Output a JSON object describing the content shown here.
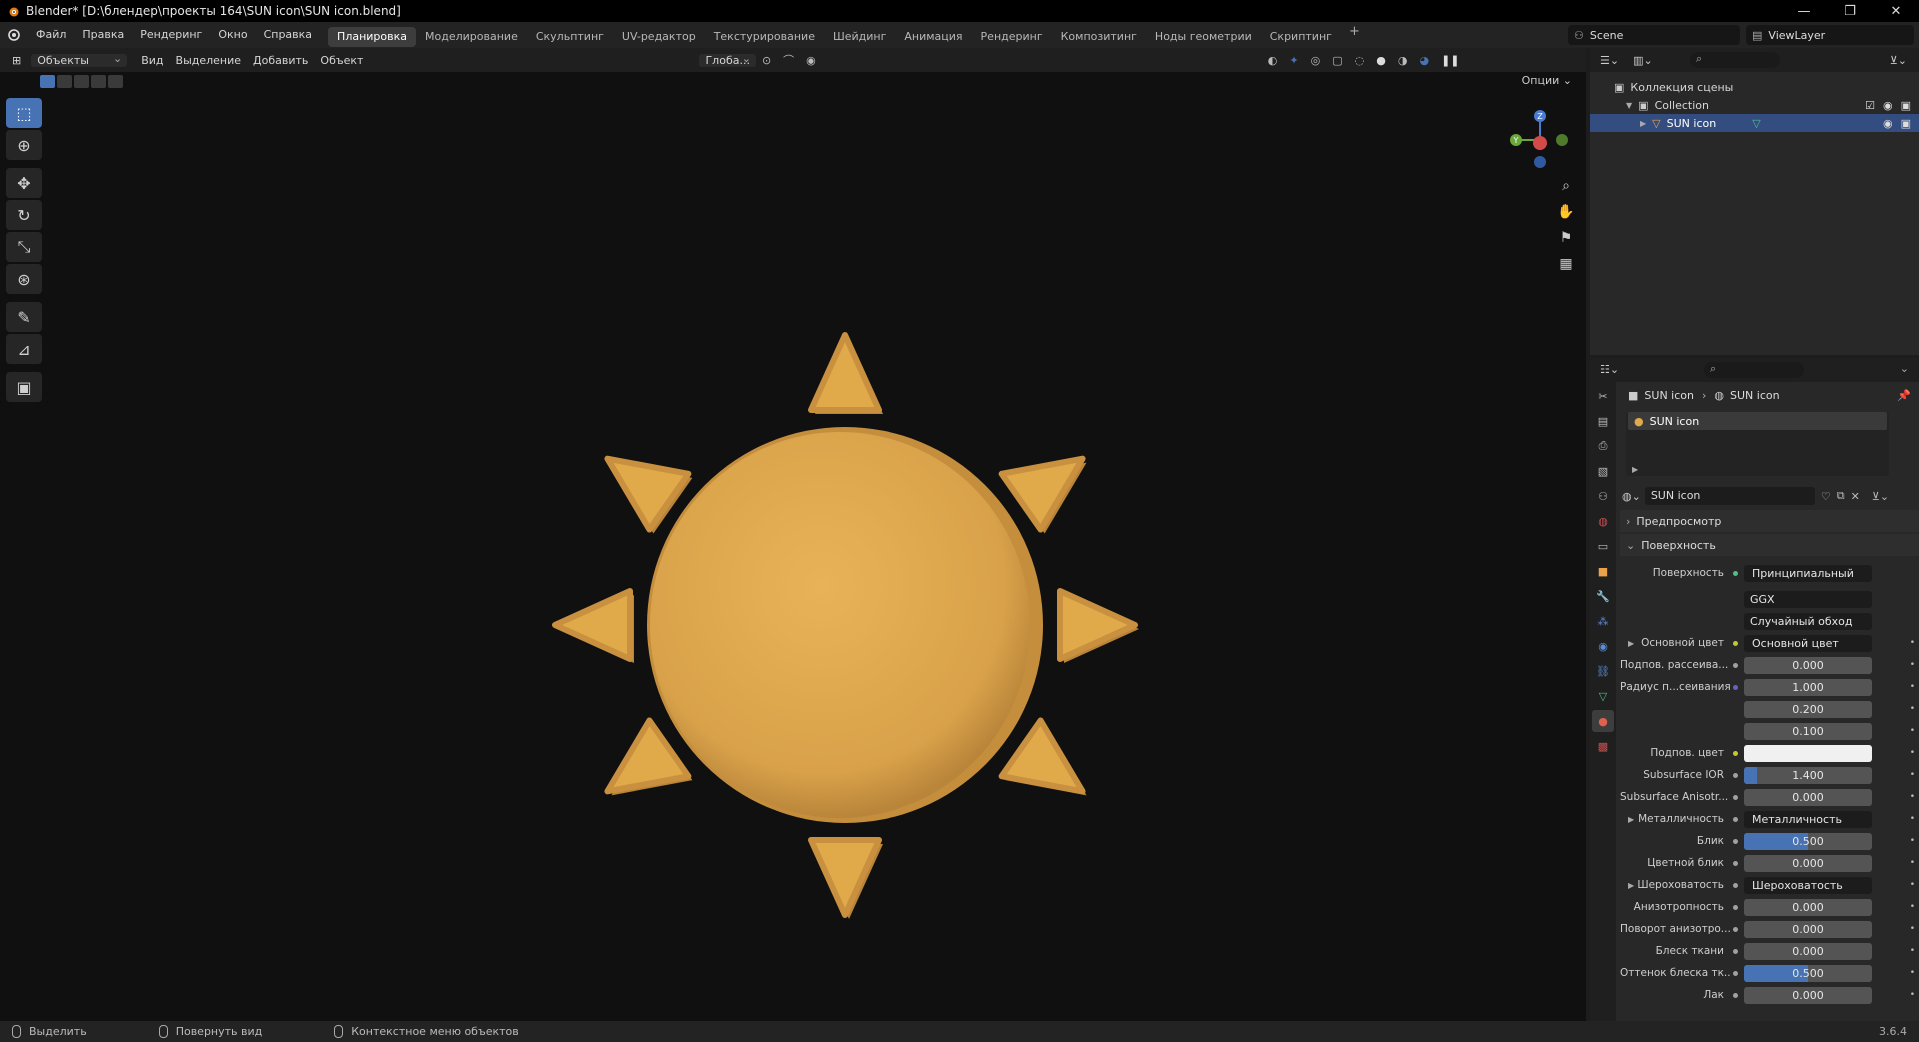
{
  "window": {
    "title": "Blender* [D:\\блендер\\проекты 164\\SUN icon\\SUN icon.blend]",
    "controls": [
      "—",
      "❐",
      "✕"
    ]
  },
  "menu": [
    "Файл",
    "Правка",
    "Рендеринг",
    "Окно",
    "Справка"
  ],
  "workspaces": [
    "Планировка",
    "Моделирование",
    "Скульптинг",
    "UV-редактор",
    "Текстурирование",
    "Шейдинг",
    "Анимация",
    "Рендеринг",
    "Композитинг",
    "Ноды геометрии",
    "Скриптинг"
  ],
  "workspace_add": "+",
  "scene": {
    "name": "Scene",
    "view_layer": "ViewLayer"
  },
  "viewport_header": {
    "mode": "Объекты",
    "menus": [
      "Вид",
      "Выделение",
      "Добавить",
      "Объект"
    ],
    "transform_orientation": "Глоба...",
    "options": "Опции"
  },
  "gizmo": {
    "z": "Z",
    "y": "Y"
  },
  "sun_color": "#e0a94a",
  "outliner": {
    "root": "Коллекция сцены",
    "collection": "Collection",
    "object": "SUN icon"
  },
  "properties": {
    "breadcrumb": [
      "SUN icon",
      "SUN icon"
    ],
    "slot": "SUN icon",
    "material": "SUN icon",
    "panels": {
      "preview": "Предпросмотр",
      "surface": "Поверхность"
    },
    "surface_label": "Поверхность",
    "surface_shader": "Принципиальный BSDF",
    "distribution": "GGX",
    "subsurface_method": "Случайный обход",
    "rows": [
      {
        "label": "Основной цвет",
        "type": "link",
        "value": "Основной цвет",
        "sock": "#c7c729",
        "expand": true
      },
      {
        "label": "Подпов. рассеива...",
        "type": "num",
        "value": "0.000",
        "sock": "#a1a1a1"
      },
      {
        "label": "Радиус п...сеивания",
        "type": "num",
        "value": "1.000",
        "sock": "#6363c7"
      },
      {
        "label": "",
        "type": "num",
        "value": "0.200",
        "sock": ""
      },
      {
        "label": "",
        "type": "num",
        "value": "0.100",
        "sock": ""
      },
      {
        "label": "Подпов. цвет",
        "type": "color",
        "value": "",
        "sock": "#c7c729"
      },
      {
        "label": "Subsurface IOR",
        "type": "num",
        "value": "1.400",
        "sock": "#a1a1a1",
        "fill": 0.1
      },
      {
        "label": "Subsurface Anisotr...",
        "type": "num",
        "value": "0.000",
        "sock": "#a1a1a1"
      },
      {
        "label": "Металличность",
        "type": "link",
        "value": "Металличность",
        "sock": "#a1a1a1",
        "expand": true
      },
      {
        "label": "Блик",
        "type": "num",
        "value": "0.500",
        "sock": "#a1a1a1",
        "fill": 0.5
      },
      {
        "label": "Цветной блик",
        "type": "num",
        "value": "0.000",
        "sock": "#a1a1a1"
      },
      {
        "label": "Шероховатость",
        "type": "link",
        "value": "Шероховатость",
        "sock": "#a1a1a1",
        "expand": true
      },
      {
        "label": "Анизотропность",
        "type": "num",
        "value": "0.000",
        "sock": "#a1a1a1"
      },
      {
        "label": "Поворот анизотро...",
        "type": "num",
        "value": "0.000",
        "sock": "#a1a1a1"
      },
      {
        "label": "Блеск ткани",
        "type": "num",
        "value": "0.000",
        "sock": "#a1a1a1"
      },
      {
        "label": "Оттенок блеска тк...",
        "type": "num",
        "value": "0.500",
        "sock": "#a1a1a1",
        "fill": 0.5
      },
      {
        "label": "Лак",
        "type": "num",
        "value": "0.000",
        "sock": "#a1a1a1"
      }
    ]
  },
  "status": {
    "select": "Выделить",
    "rotate": "Повернуть вид",
    "context": "Контекстное меню объектов",
    "version": "3.6.4"
  }
}
